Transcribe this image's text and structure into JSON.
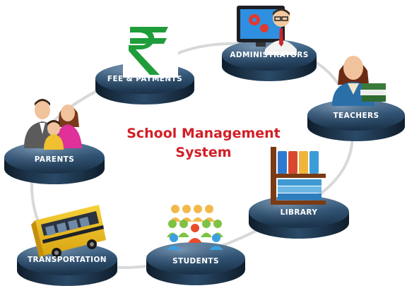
{
  "diagram": {
    "title_line1": "School Management",
    "title_line2": "System",
    "colors": {
      "title": "#d21f26",
      "disc_top": "#2b4d6b",
      "disc_side": "#16283a",
      "ring": "#d8dadc"
    },
    "nodes": [
      {
        "id": "fee",
        "label": "FEE & PAYMENTS",
        "icon": "rupee-icon"
      },
      {
        "id": "admin",
        "label": "ADMINISTRATORS",
        "icon": "administrator-icon"
      },
      {
        "id": "teachers",
        "label": "TEACHERS",
        "icon": "teacher-icon"
      },
      {
        "id": "library",
        "label": "LIBRARY",
        "icon": "bookshelf-icon"
      },
      {
        "id": "students",
        "label": "STUDENTS",
        "icon": "students-icon"
      },
      {
        "id": "transport",
        "label": "TRANSPORTATION",
        "icon": "school-bus-icon"
      },
      {
        "id": "parents",
        "label": "PARENTS",
        "icon": "family-icon"
      }
    ]
  }
}
